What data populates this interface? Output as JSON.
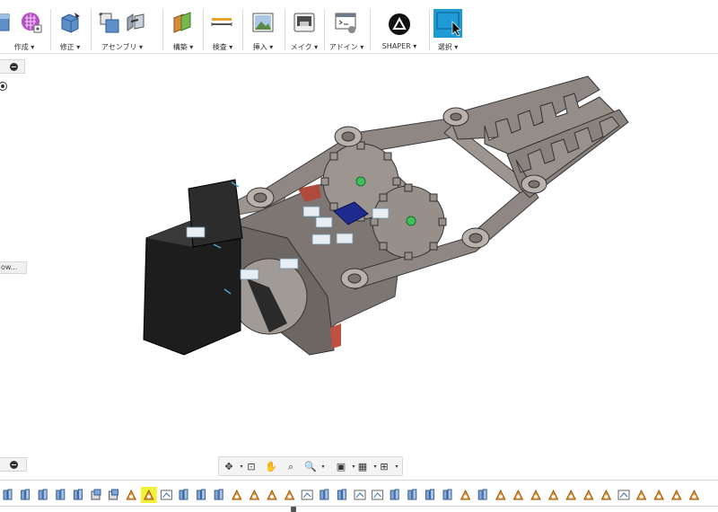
{
  "toolbar": {
    "groups": [
      {
        "key": "create",
        "label": "作成 ▾"
      },
      {
        "key": "modify",
        "label": "修正 ▾"
      },
      {
        "key": "assemble",
        "label": "アセンブリ ▾"
      },
      {
        "key": "construct",
        "label": "構築 ▾"
      },
      {
        "key": "inspect",
        "label": "検査 ▾"
      },
      {
        "key": "insert",
        "label": "挿入 ▾"
      },
      {
        "key": "make",
        "label": "メイク ▾"
      },
      {
        "key": "addins",
        "label": "アドイン ▾"
      },
      {
        "key": "shaper",
        "label": "SHAPER ▾"
      },
      {
        "key": "select",
        "label": "選択 ▾"
      }
    ]
  },
  "browser": {
    "partial_item": "ow..."
  },
  "icons": {
    "create": "sketch-grid-icon",
    "modify": "push-pull-icon",
    "assemble": "new-component-icon",
    "construct": "offset-plane-icon",
    "inspect": "measure-icon",
    "insert": "insert-image-icon",
    "make": "3d-print-icon",
    "addins": "scripts-icon",
    "shaper": "shaper-logo-icon",
    "select": "select-cursor-icon"
  },
  "colors": {
    "accent": "#1e9ad6",
    "highlight": "#f3f03a",
    "part_gray": "#8f8783",
    "servo_black": "#1d1d1d",
    "joint_green": "#3fbf5a",
    "blue_part": "#1f2a8f"
  }
}
